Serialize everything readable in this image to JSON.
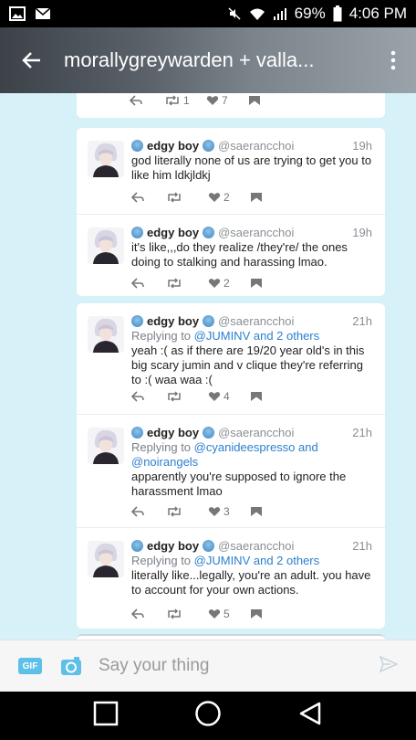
{
  "status_bar": {
    "battery": "69%",
    "time": "4:06 PM"
  },
  "header": {
    "title": "morallygreywarden + valla..."
  },
  "top_partial": {
    "retweets": "1",
    "likes": "7"
  },
  "tweets": [
    {
      "name": "edgy boy",
      "handle": "@saerancchoi",
      "time": "19h",
      "body": "god literally none of us are trying to get you to like him ldkjldkj",
      "retweets": "",
      "likes": "2"
    },
    {
      "name": "edgy boy",
      "handle": "@saerancchoi",
      "time": "19h",
      "body": "it's like,,,do they realize /they're/ the ones doing to stalking and harassing lmao.",
      "retweets": "",
      "likes": "2"
    },
    {
      "name": "edgy boy",
      "handle": "@saerancchoi",
      "time": "21h",
      "reply_prefix": "Replying to ",
      "reply_to": "@JUMINV and 2 others",
      "body": "yeah :( as if there are 19/20 year old's in this big scary jumin and v clique they're referring to :( waa waa :(",
      "retweets": "",
      "likes": "4"
    },
    {
      "name": "edgy boy",
      "handle": "@saerancchoi",
      "time": "21h",
      "reply_prefix": "Replying to ",
      "reply_to": "@cyanideespresso and",
      "reply_to_2": "@noirangels",
      "body": "apparently you're supposed to ignore the harassment lmao",
      "retweets": "",
      "likes": "3"
    },
    {
      "name": "edgy boy",
      "handle": "@saerancchoi",
      "time": "21h",
      "reply_prefix": "Replying to ",
      "reply_to": "@JUMINV and 2 others",
      "body": "literally like...legally, you're an adult. you have to account for your own actions.",
      "retweets": "",
      "likes": "5"
    }
  ],
  "input_bar": {
    "gif_label": "GIF",
    "placeholder": "Say your thing"
  },
  "colors": {
    "background": "#d6f1f7",
    "link": "#2b7fd0",
    "accent": "#5cc0e8"
  }
}
